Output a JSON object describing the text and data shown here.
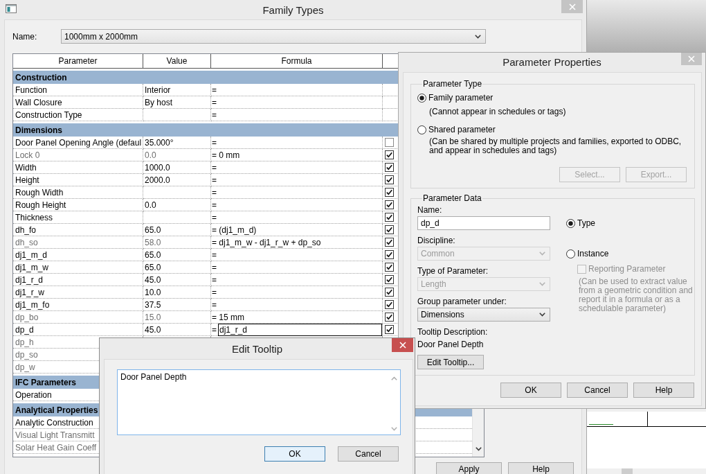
{
  "family_types": {
    "title": "Family Types",
    "active": false,
    "name_label": "Name:",
    "type_name": "1000mm x 2000mm",
    "table": {
      "columns": [
        "Parameter",
        "Value",
        "Formula"
      ],
      "rows": [
        {
          "kind": "group",
          "label": "Construction"
        },
        {
          "kind": "parameter",
          "name": "Function",
          "value": "Interior",
          "formula": "=",
          "disabled": false
        },
        {
          "kind": "parameter",
          "name": "Wall Closure",
          "value": "By host",
          "formula": "=",
          "disabled": false
        },
        {
          "kind": "parameter",
          "name": "Construction Type",
          "formula": "=",
          "disabled": false
        },
        {
          "kind": "group",
          "label": "Dimensions"
        },
        {
          "kind": "parameter",
          "name": "Door Panel Opening Angle (defaul",
          "value": "35.000°",
          "formula": "=",
          "disabled": false,
          "checked": false
        },
        {
          "kind": "parameter",
          "name": "Lock 0",
          "value": "0.0",
          "formula": "= 0 mm",
          "disabled": true,
          "checked": true
        },
        {
          "kind": "parameter",
          "name": "Width",
          "value": "1000.0",
          "formula": "=",
          "disabled": false,
          "checked": true
        },
        {
          "kind": "parameter",
          "name": "Height",
          "value": "2000.0",
          "formula": "=",
          "disabled": false,
          "checked": true
        },
        {
          "kind": "parameter",
          "name": "Rough Width",
          "formula": "=",
          "disabled": false,
          "checked": true
        },
        {
          "kind": "parameter",
          "name": "Rough Height",
          "value": "0.0",
          "formula": "=",
          "disabled": false,
          "checked": true
        },
        {
          "kind": "parameter",
          "name": "Thickness",
          "formula": "=",
          "disabled": false,
          "checked": true
        },
        {
          "kind": "parameter",
          "name": "dh_fo",
          "value": "65.0",
          "formula": "= (dj1_m_d)",
          "disabled": false,
          "checked": true
        },
        {
          "kind": "parameter",
          "name": "dh_so",
          "value": "58.0",
          "formula": "= dj1_m_w - dj1_r_w + dp_so",
          "disabled": true,
          "checked": true
        },
        {
          "kind": "parameter",
          "name": "dj1_m_d",
          "value": "65.0",
          "formula": "=",
          "disabled": false,
          "checked": true
        },
        {
          "kind": "parameter",
          "name": "dj1_m_w",
          "value": "65.0",
          "formula": "=",
          "disabled": false,
          "checked": true
        },
        {
          "kind": "parameter",
          "name": "dj1_r_d",
          "value": "45.0",
          "formula": "=",
          "disabled": false,
          "checked": true
        },
        {
          "kind": "parameter",
          "name": "dj1_r_w",
          "value": "10.0",
          "formula": "=",
          "disabled": false,
          "checked": true
        },
        {
          "kind": "parameter",
          "name": "dj1_m_fo",
          "value": "37.5",
          "formula": "=",
          "disabled": false,
          "checked": true
        },
        {
          "kind": "parameter",
          "name": "dp_bo",
          "value": "15.0",
          "formula": "= 15 mm",
          "disabled": true,
          "checked": true
        },
        {
          "kind": "parameter",
          "name": "dp_d",
          "value": "45.0",
          "formula": "=",
          "formula_input": "dj1_r_d",
          "disabled": false,
          "checked": true
        },
        {
          "kind": "parameter",
          "name": "dp_h",
          "disabled": true
        },
        {
          "kind": "parameter",
          "name": "dp_so",
          "disabled": true
        },
        {
          "kind": "parameter",
          "name": "dp_w",
          "disabled": true
        },
        {
          "kind": "group",
          "label": "IFC Parameters"
        },
        {
          "kind": "parameter",
          "name": "Operation",
          "disabled": false
        },
        {
          "kind": "group",
          "label": "Analytical Properties"
        },
        {
          "kind": "parameter",
          "name": "Analytic Construction",
          "disabled": false
        },
        {
          "kind": "parameter",
          "name": "Visual Light Transmitt",
          "disabled": true
        },
        {
          "kind": "parameter",
          "name": "Solar Heat Gain Coeff",
          "disabled": true
        }
      ]
    },
    "buttons": [
      "Apply",
      "Help"
    ]
  },
  "parameter_properties": {
    "title": "Parameter Properties",
    "active": false,
    "parameter_type": {
      "legend": "Parameter Type",
      "options": [
        {
          "label": "Family parameter",
          "note": "(Cannot appear in schedules or tags)",
          "selected": true
        },
        {
          "label": "Shared parameter",
          "note": "(Can be shared by multiple projects and families, exported to ODBC, and appear in schedules and tags)",
          "selected": false
        }
      ],
      "buttons": [
        {
          "label": "Select...",
          "disabled": true
        },
        {
          "label": "Export...",
          "disabled": true
        }
      ]
    },
    "parameter_data": {
      "legend": "Parameter Data",
      "fields": [
        {
          "label": "Name:",
          "kind": "text",
          "value": "dp_d",
          "disabled": false
        },
        {
          "label": "Discipline:",
          "kind": "select",
          "value": "Common",
          "disabled": true
        },
        {
          "label": "Type of Parameter:",
          "kind": "select",
          "value": "Length",
          "disabled": true
        },
        {
          "label": "Group parameter under:",
          "kind": "select",
          "value": "Dimensions",
          "disabled": false
        }
      ],
      "scope": [
        {
          "label": "Type",
          "selected": true
        },
        {
          "label": "Instance",
          "selected": false
        }
      ],
      "reporting": {
        "label": "Reporting Parameter",
        "checked": false,
        "disabled": true,
        "note": "(Can be used to extract value from a geometric condition and report it in a formula or as a schedulable parameter)"
      },
      "tooltip_label": "Tooltip Description:",
      "tooltip": "Door Panel Depth",
      "edit_tooltip_button": "Edit Tooltip..."
    },
    "buttons": [
      "OK",
      "Cancel",
      "Help"
    ]
  },
  "edit_tooltip": {
    "title": "Edit Tooltip",
    "active": true,
    "text": "Door Panel Depth",
    "buttons": [
      {
        "label": "OK",
        "focused": true
      },
      {
        "label": "Cancel",
        "focused": false
      }
    ]
  }
}
